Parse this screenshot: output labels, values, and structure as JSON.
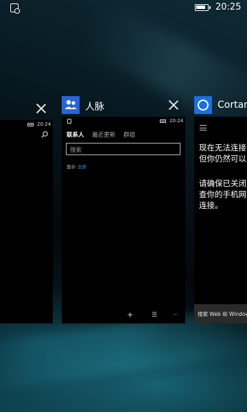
{
  "status_bar": {
    "time": "20:25",
    "notification_icon": "notification-icon",
    "battery_icon": "battery-icon"
  },
  "cards": {
    "left": {
      "mini_time": "20:24",
      "search_icon": "search-icon"
    },
    "people": {
      "title": "人脉",
      "icon": "people-icon",
      "mini_time": "20:24",
      "tabs": [
        "联系人",
        "最近更新",
        "群组"
      ],
      "search_placeholder": "搜索",
      "show_label": "显示",
      "show_link": "全部",
      "appbar": {
        "add": "+",
        "select": "☰",
        "more": "···"
      }
    },
    "cortana": {
      "title": "Cortana",
      "icon": "cortana-icon",
      "message_line1": "现在无法连接",
      "message_line2": "但你仍然可以",
      "message_line3": "请确保已关闭",
      "message_line4": "查你的手机网",
      "message_line5": "连接。",
      "footer": "搜索 Web 和 Windows"
    }
  }
}
